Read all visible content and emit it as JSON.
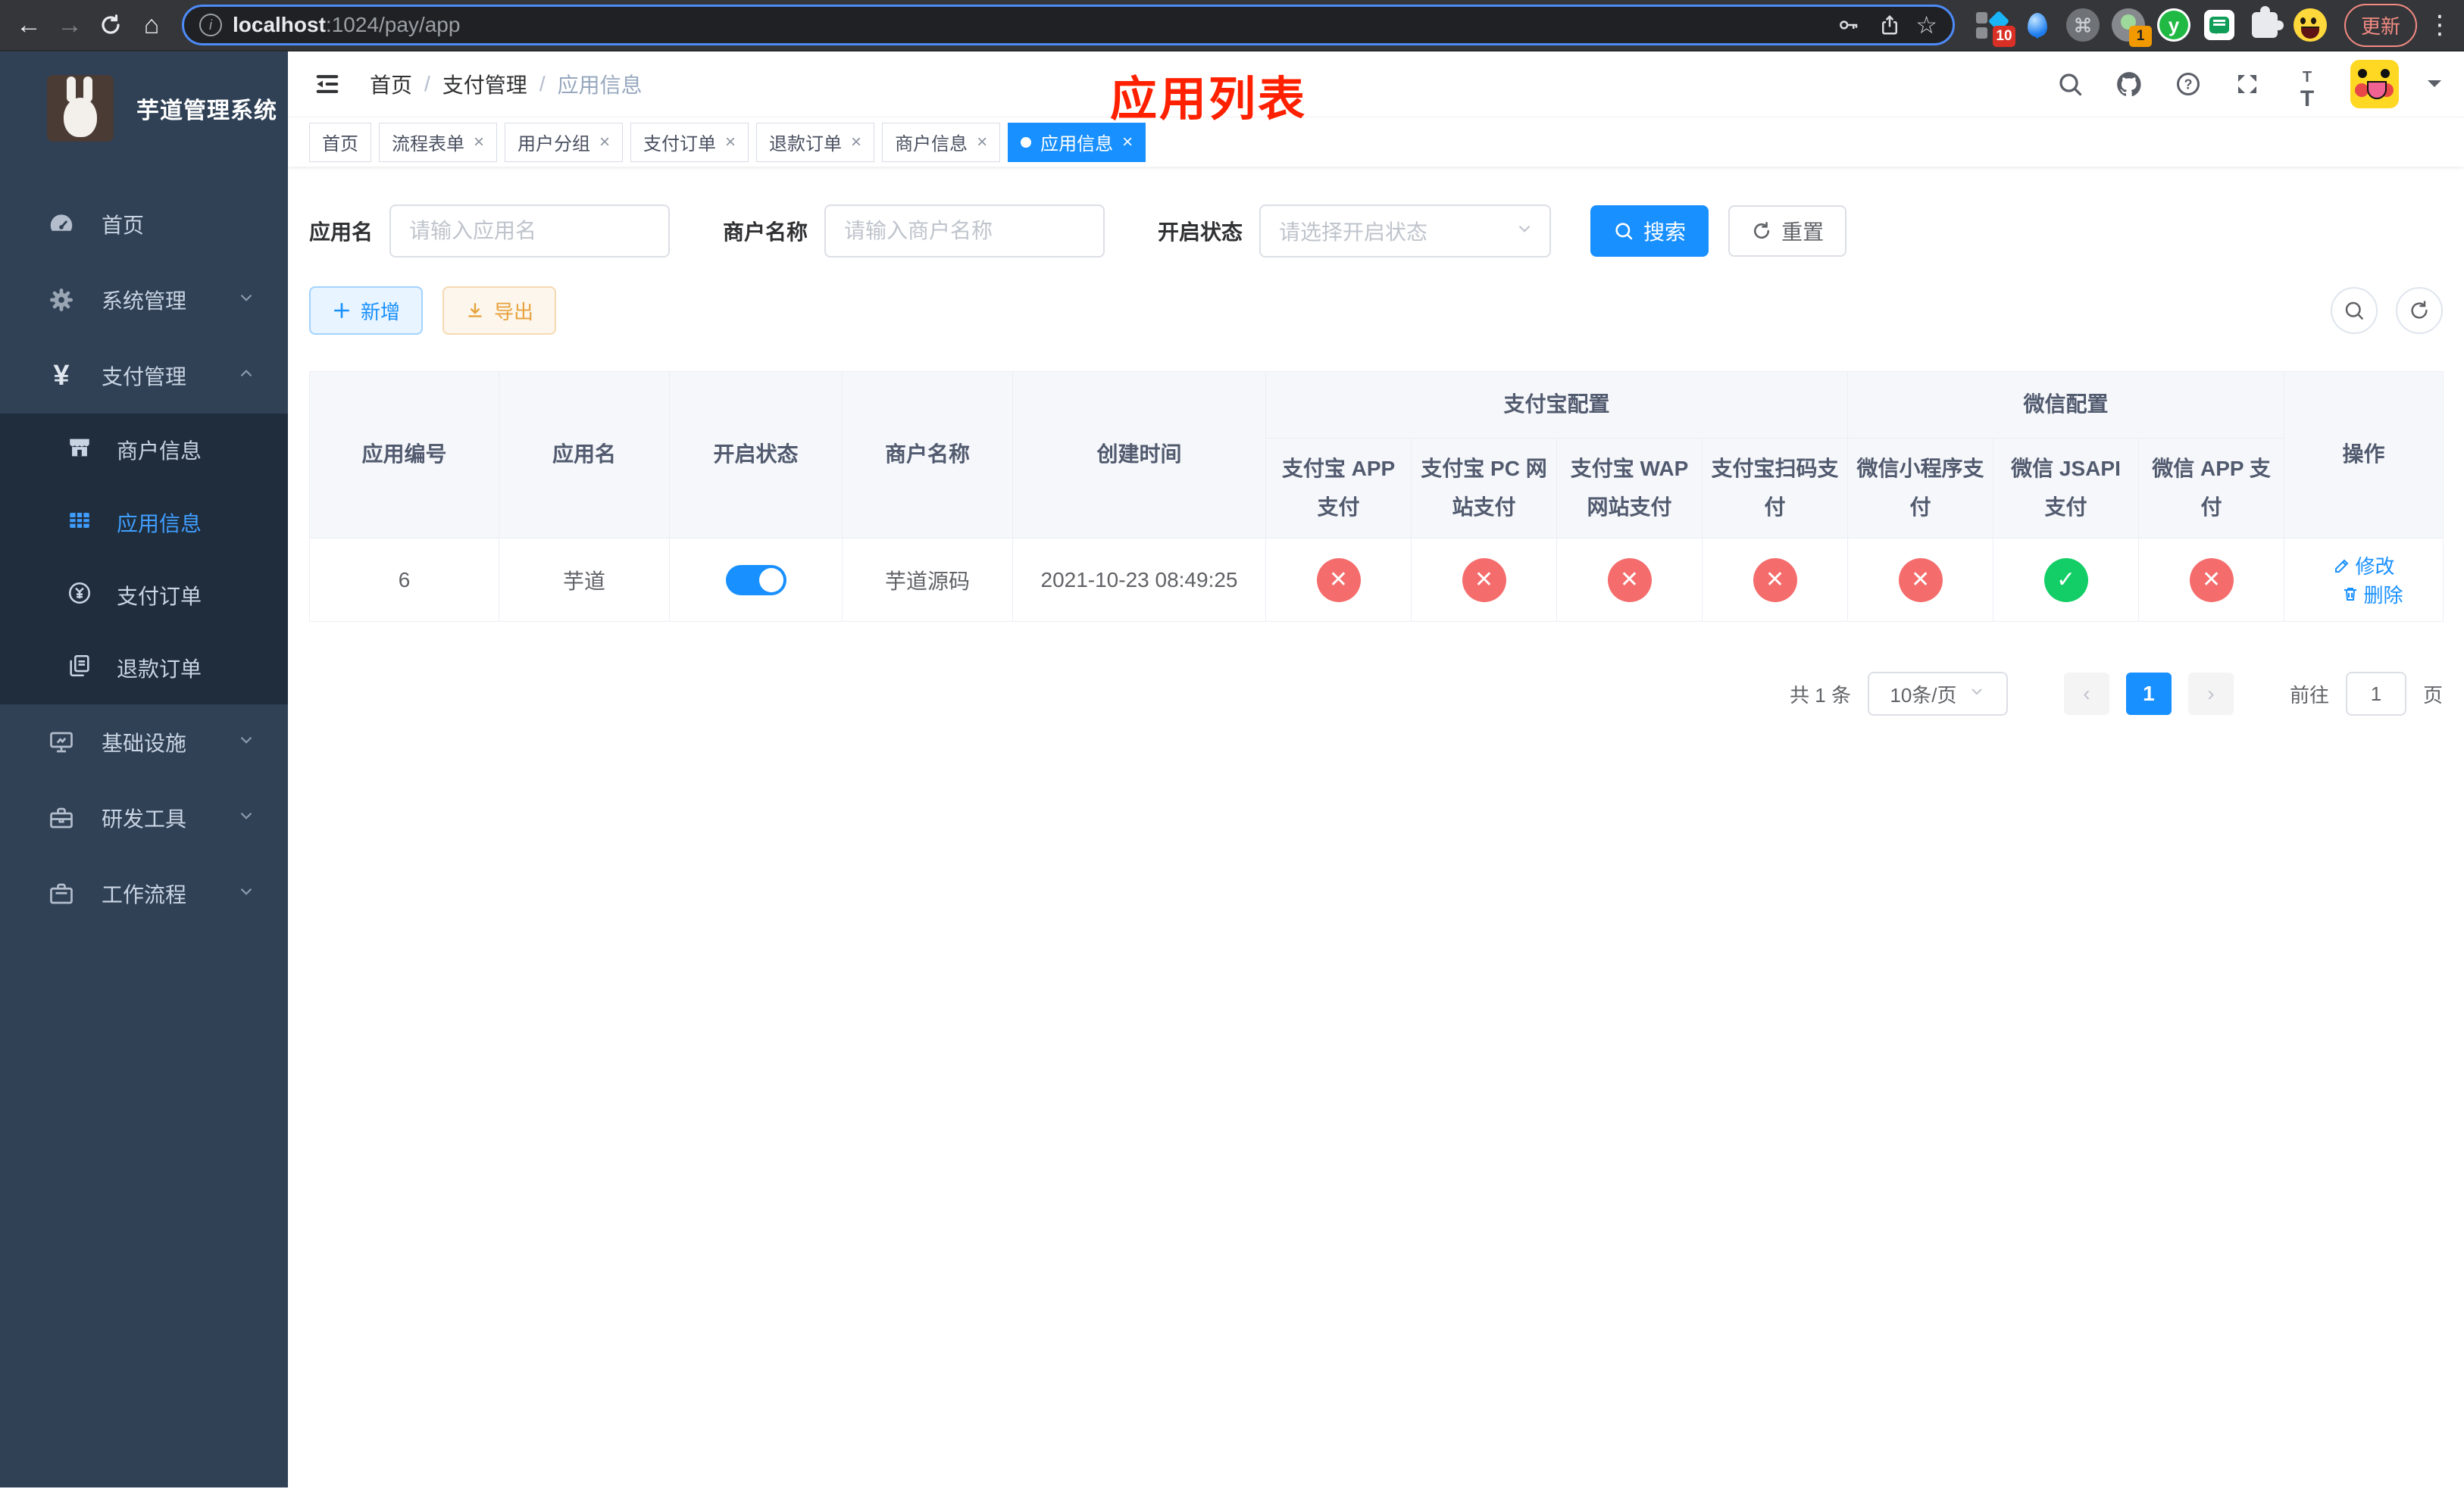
{
  "colors": {
    "primary": "#1890ff",
    "menu_active": "#409eff",
    "danger_red": "#f56c6c",
    "success_green": "#13ce66",
    "export_orange": "#e6a23c",
    "annotation_red": "#ff2000",
    "sidebar_bg": "#304156",
    "submenu_bg": "#1f2d3d"
  },
  "browser": {
    "url": {
      "host": "localhost",
      "path": ":1024/pay/app"
    },
    "update_button": "更新",
    "ext_badge_translate": "10",
    "ext_badge_one": "1",
    "ext_y_letter": "y"
  },
  "sidebar": {
    "logo_title": "芋道管理系统",
    "items": [
      {
        "label": "首页"
      },
      {
        "label": "系统管理"
      },
      {
        "label": "支付管理"
      },
      {
        "label": "商户信息"
      },
      {
        "label": "应用信息"
      },
      {
        "label": "支付订单"
      },
      {
        "label": "退款订单"
      },
      {
        "label": "基础设施"
      },
      {
        "label": "研发工具"
      },
      {
        "label": "工作流程"
      }
    ]
  },
  "navbar": {
    "breadcrumb": {
      "home": "首页",
      "section": "支付管理",
      "current": "应用信息",
      "separator": "/"
    },
    "annotation": "应用列表"
  },
  "tabs": [
    {
      "label": "首页"
    },
    {
      "label": "流程表单"
    },
    {
      "label": "用户分组"
    },
    {
      "label": "支付订单"
    },
    {
      "label": "退款订单"
    },
    {
      "label": "商户信息"
    },
    {
      "label": "应用信息"
    }
  ],
  "filters": {
    "app_name": {
      "label": "应用名",
      "placeholder": "请输入应用名",
      "value": ""
    },
    "merchant_name": {
      "label": "商户名称",
      "placeholder": "请输入商户名称",
      "value": ""
    },
    "status": {
      "label": "开启状态",
      "placeholder": "请选择开启状态"
    },
    "search_button": "搜索",
    "reset_button": "重置"
  },
  "toolbar": {
    "add_button": "新增",
    "export_button": "导出"
  },
  "table": {
    "headers": {
      "app_id": "应用编号",
      "app_name": "应用名",
      "status": "开启状态",
      "merchant": "商户名称",
      "created": "创建时间",
      "alipay_group": "支付宝配置",
      "wechat_group": "微信配置",
      "actions": "操作",
      "alipay_app": "支付宝 APP 支付",
      "alipay_pc": "支付宝 PC 网站支付",
      "alipay_wap": "支付宝 WAP 网站支付",
      "alipay_qr": "支付宝扫码支付",
      "wx_mini": "微信小程序支付",
      "wx_jsapi": "微信 JSAPI 支付",
      "wx_app": "微信 APP 支付"
    },
    "rows": [
      {
        "app_id": "6",
        "app_name": "芋道",
        "status_enabled": true,
        "merchant": "芋道源码",
        "created": "2021-10-23 08:49:25",
        "payments": {
          "alipay_app": "disabled",
          "alipay_pc": "disabled",
          "alipay_wap": "disabled",
          "alipay_qr": "disabled",
          "wx_mini": "disabled",
          "wx_jsapi": "enabled",
          "wx_app": "disabled"
        },
        "edit_label": "修改",
        "delete_label": "删除"
      }
    ]
  },
  "pagination": {
    "total": "共 1 条",
    "page_size": "10条/页",
    "current_page": "1",
    "goto_prefix": "前往",
    "goto_value": "1",
    "goto_suffix": "页"
  },
  "glyphs": {
    "back": "←",
    "forward": "→",
    "home": "⌂",
    "star": "☆",
    "more": "⋮",
    "info": "i",
    "question": "?",
    "yen": "¥",
    "close": "×",
    "check": "✓",
    "cross": "✕",
    "chevron_prev": "‹",
    "chevron_next": "›",
    "font_size": "tT"
  }
}
